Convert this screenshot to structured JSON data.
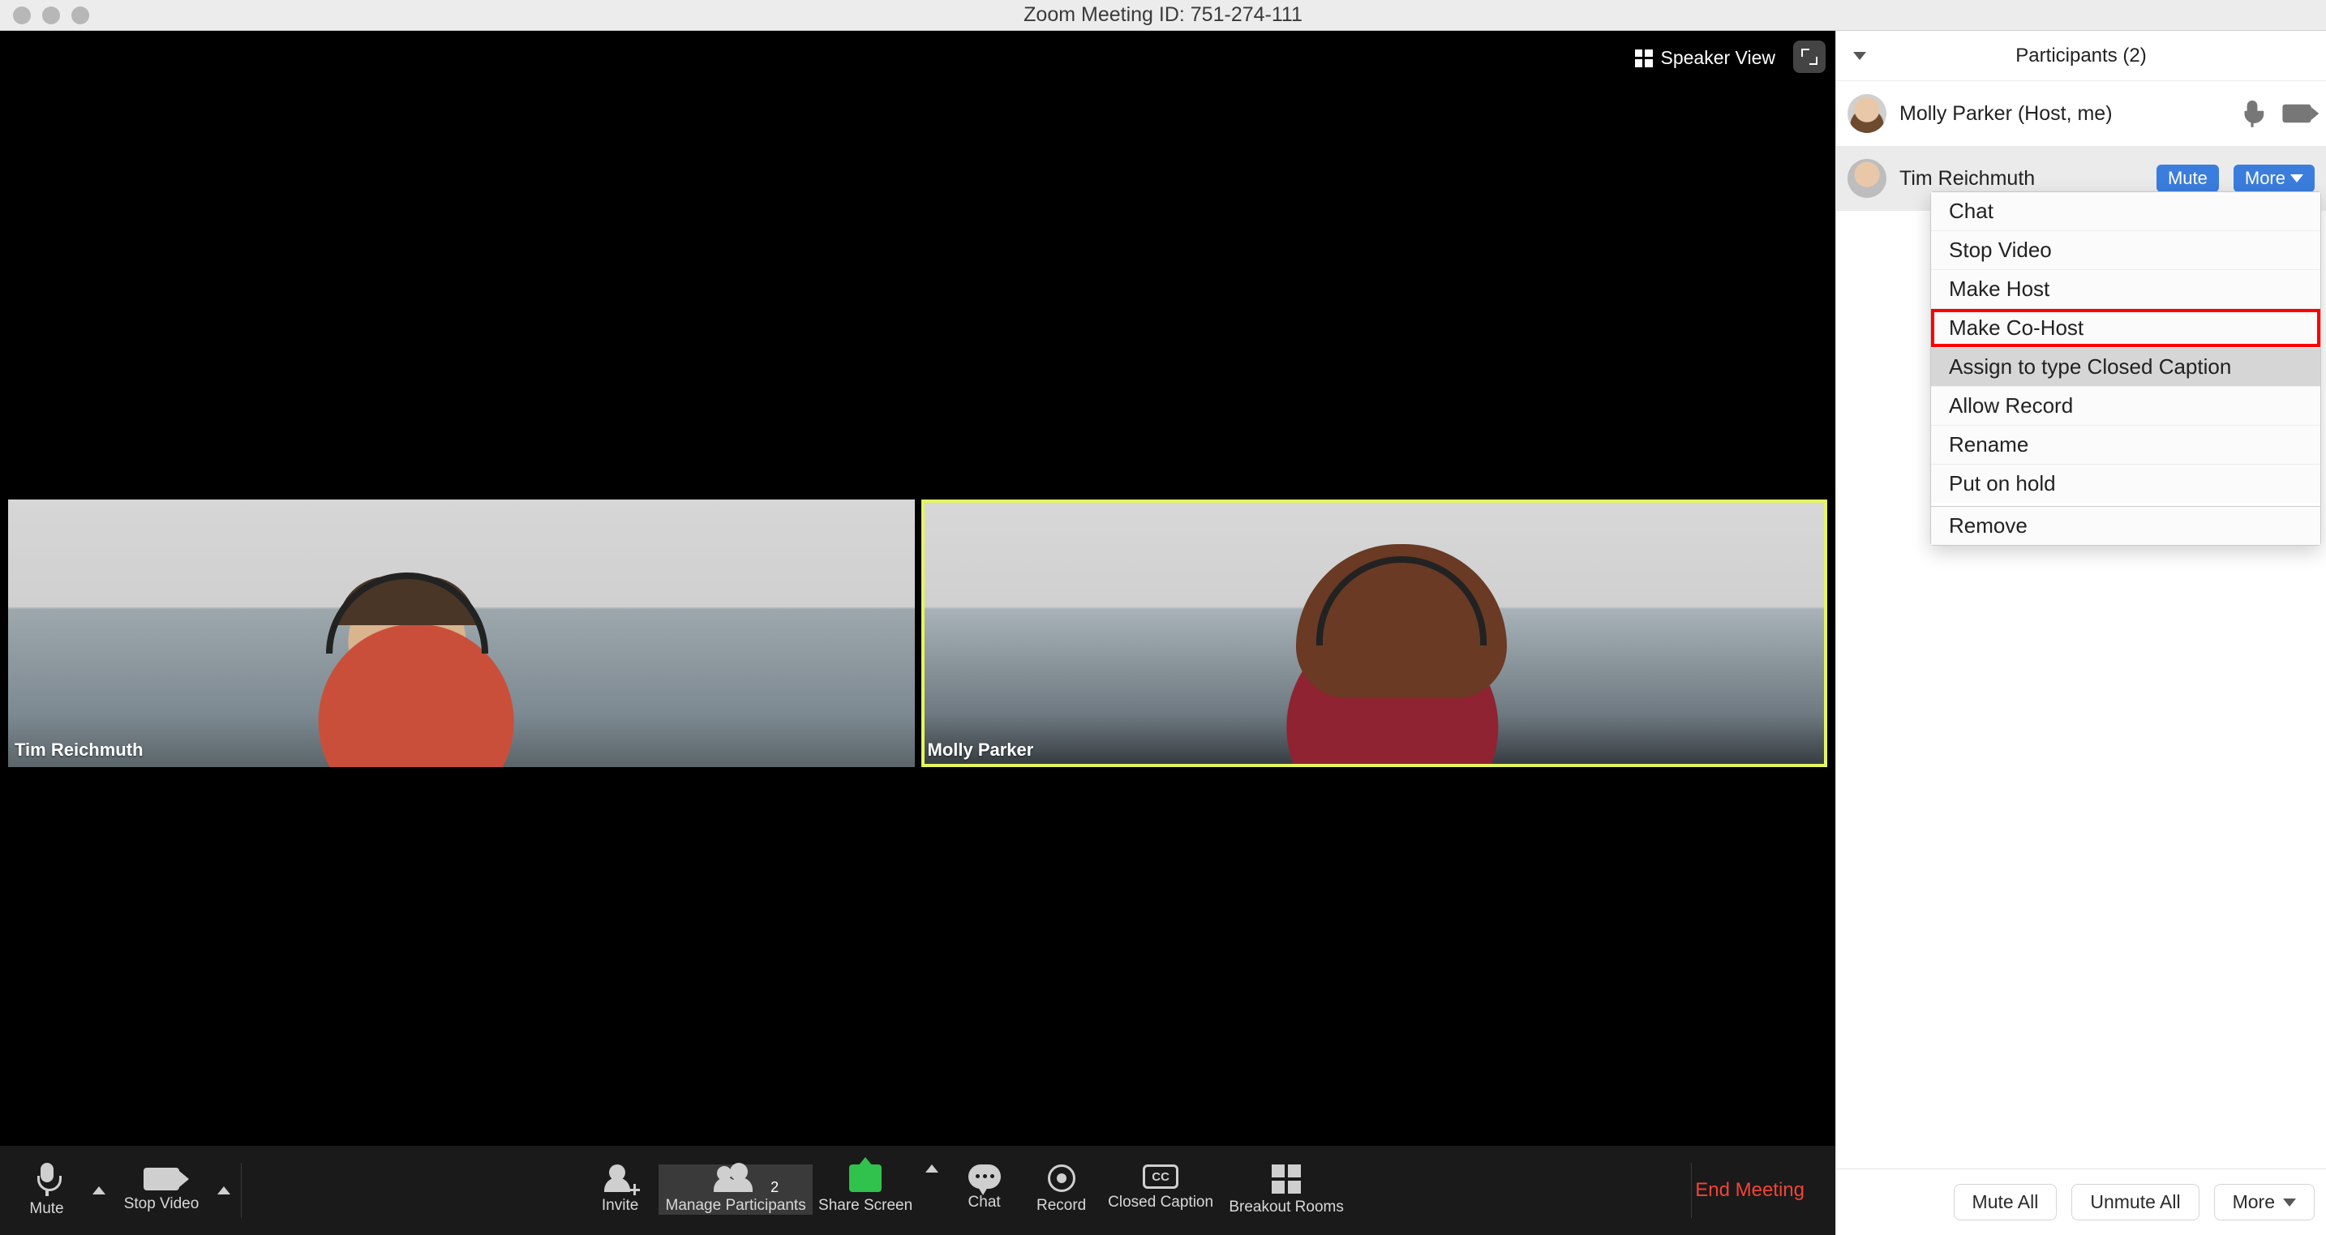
{
  "titlebar": {
    "text": "Zoom Meeting ID: 751-274-111"
  },
  "video_controls": {
    "speaker_view_label": "Speaker View"
  },
  "tiles": [
    {
      "name": "Tim Reichmuth",
      "active_speaker": false
    },
    {
      "name": "Molly Parker",
      "active_speaker": true
    }
  ],
  "toolbar": {
    "mute": "Mute",
    "stop_video": "Stop Video",
    "invite": "Invite",
    "manage_participants": "Manage Participants",
    "participants_count": "2",
    "share_screen": "Share Screen",
    "chat": "Chat",
    "record": "Record",
    "closed_caption": "Closed Caption",
    "breakout_rooms": "Breakout Rooms",
    "end_meeting": "End Meeting"
  },
  "panel": {
    "title": "Participants (2)",
    "rows": [
      {
        "name": "Molly Parker (Host, me)"
      },
      {
        "name": "Tim Reichmuth"
      }
    ],
    "mute_btn": "Mute",
    "more_btn": "More",
    "footer": {
      "mute_all": "Mute All",
      "unmute_all": "Unmute All",
      "more": "More"
    }
  },
  "menu": {
    "chat": "Chat",
    "stop_video": "Stop Video",
    "make_host": "Make Host",
    "make_cohost": "Make Co-Host",
    "assign_cc": "Assign to type Closed Caption",
    "allow_record": "Allow Record",
    "rename": "Rename",
    "put_on_hold": "Put on hold",
    "remove": "Remove"
  }
}
